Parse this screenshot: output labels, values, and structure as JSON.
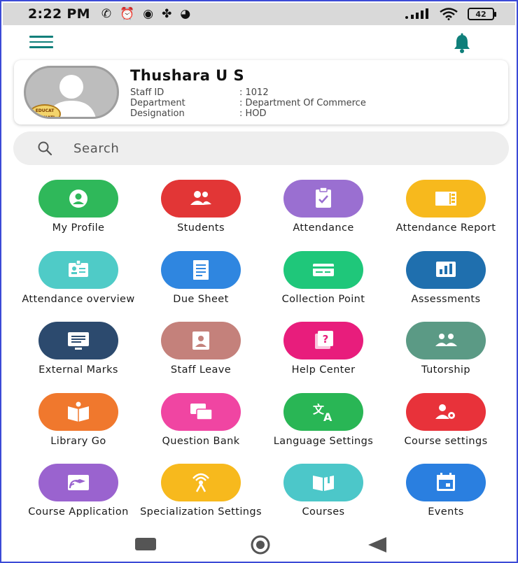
{
  "status_bar": {
    "time": "2:22 PM",
    "battery": "42"
  },
  "profile": {
    "name": "Thushara U S",
    "badge_text": "EDUCAT\nTERNATI",
    "rows": [
      {
        "label": "Staff ID",
        "value": ": 1012"
      },
      {
        "label": "Department",
        "value": ": Department Of Commerce"
      },
      {
        "label": "Designation",
        "value": ": HOD"
      }
    ]
  },
  "search": {
    "placeholder": "Search"
  },
  "colors": {
    "accent": "#0f7f7a",
    "tiles": [
      "#2fb85a",
      "#e23636",
      "#9a6fd1",
      "#f7b91d",
      "#4fcbc7",
      "#2f86e0",
      "#1fc77a",
      "#1f6fae",
      "#2c4a6e",
      "#c4817b",
      "#e81d7c",
      "#5b9a85",
      "#f0782d",
      "#f045a2",
      "#29b655",
      "#e8323a",
      "#9a63cf",
      "#f7b91d",
      "#4cc7c9",
      "#2a7fe0"
    ]
  },
  "tiles": [
    {
      "label": "My Profile",
      "icon": "profile-icon"
    },
    {
      "label": "Students",
      "icon": "students-icon"
    },
    {
      "label": "Attendance",
      "icon": "attendance-icon"
    },
    {
      "label": "Attendance Report",
      "icon": "attendance-report-icon"
    },
    {
      "label": "Attendance overview",
      "icon": "attendance-overview-icon"
    },
    {
      "label": "Due Sheet",
      "icon": "due-sheet-icon"
    },
    {
      "label": "Collection Point",
      "icon": "collection-point-icon"
    },
    {
      "label": "Assessments",
      "icon": "assessments-icon"
    },
    {
      "label": "External Marks",
      "icon": "external-marks-icon"
    },
    {
      "label": "Staff Leave",
      "icon": "staff-leave-icon"
    },
    {
      "label": "Help Center",
      "icon": "help-center-icon"
    },
    {
      "label": "Tutorship",
      "icon": "tutorship-icon"
    },
    {
      "label": "Library Go",
      "icon": "library-icon"
    },
    {
      "label": "Question Bank",
      "icon": "question-bank-icon"
    },
    {
      "label": "Language Settings",
      "icon": "language-icon"
    },
    {
      "label": "Course settings",
      "icon": "course-settings-icon"
    },
    {
      "label": "Course Application",
      "icon": "course-application-icon"
    },
    {
      "label": "Specialization Settings",
      "icon": "specialization-icon"
    },
    {
      "label": "Courses",
      "icon": "courses-icon"
    },
    {
      "label": "Events",
      "icon": "events-icon"
    }
  ]
}
